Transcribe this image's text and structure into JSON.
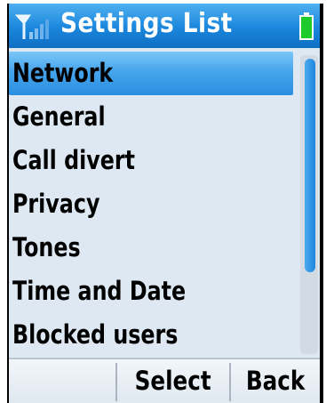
{
  "header": {
    "title": "Settings List",
    "signal_icon": "signal-strength-icon",
    "battery_icon": "battery-icon",
    "battery_color": "#1ecb2a"
  },
  "list": {
    "items": [
      {
        "label": "Network",
        "selected": true
      },
      {
        "label": "General",
        "selected": false
      },
      {
        "label": "Call divert",
        "selected": false
      },
      {
        "label": "Privacy",
        "selected": false
      },
      {
        "label": "Tones",
        "selected": false
      },
      {
        "label": "Time and Date",
        "selected": false
      },
      {
        "label": "Blocked users",
        "selected": false
      }
    ]
  },
  "softkeys": {
    "left_label": "",
    "center_label": "Select",
    "right_label": "Back"
  },
  "colors": {
    "accent": "#2b8fe0",
    "list_background": "#dde8f3"
  }
}
